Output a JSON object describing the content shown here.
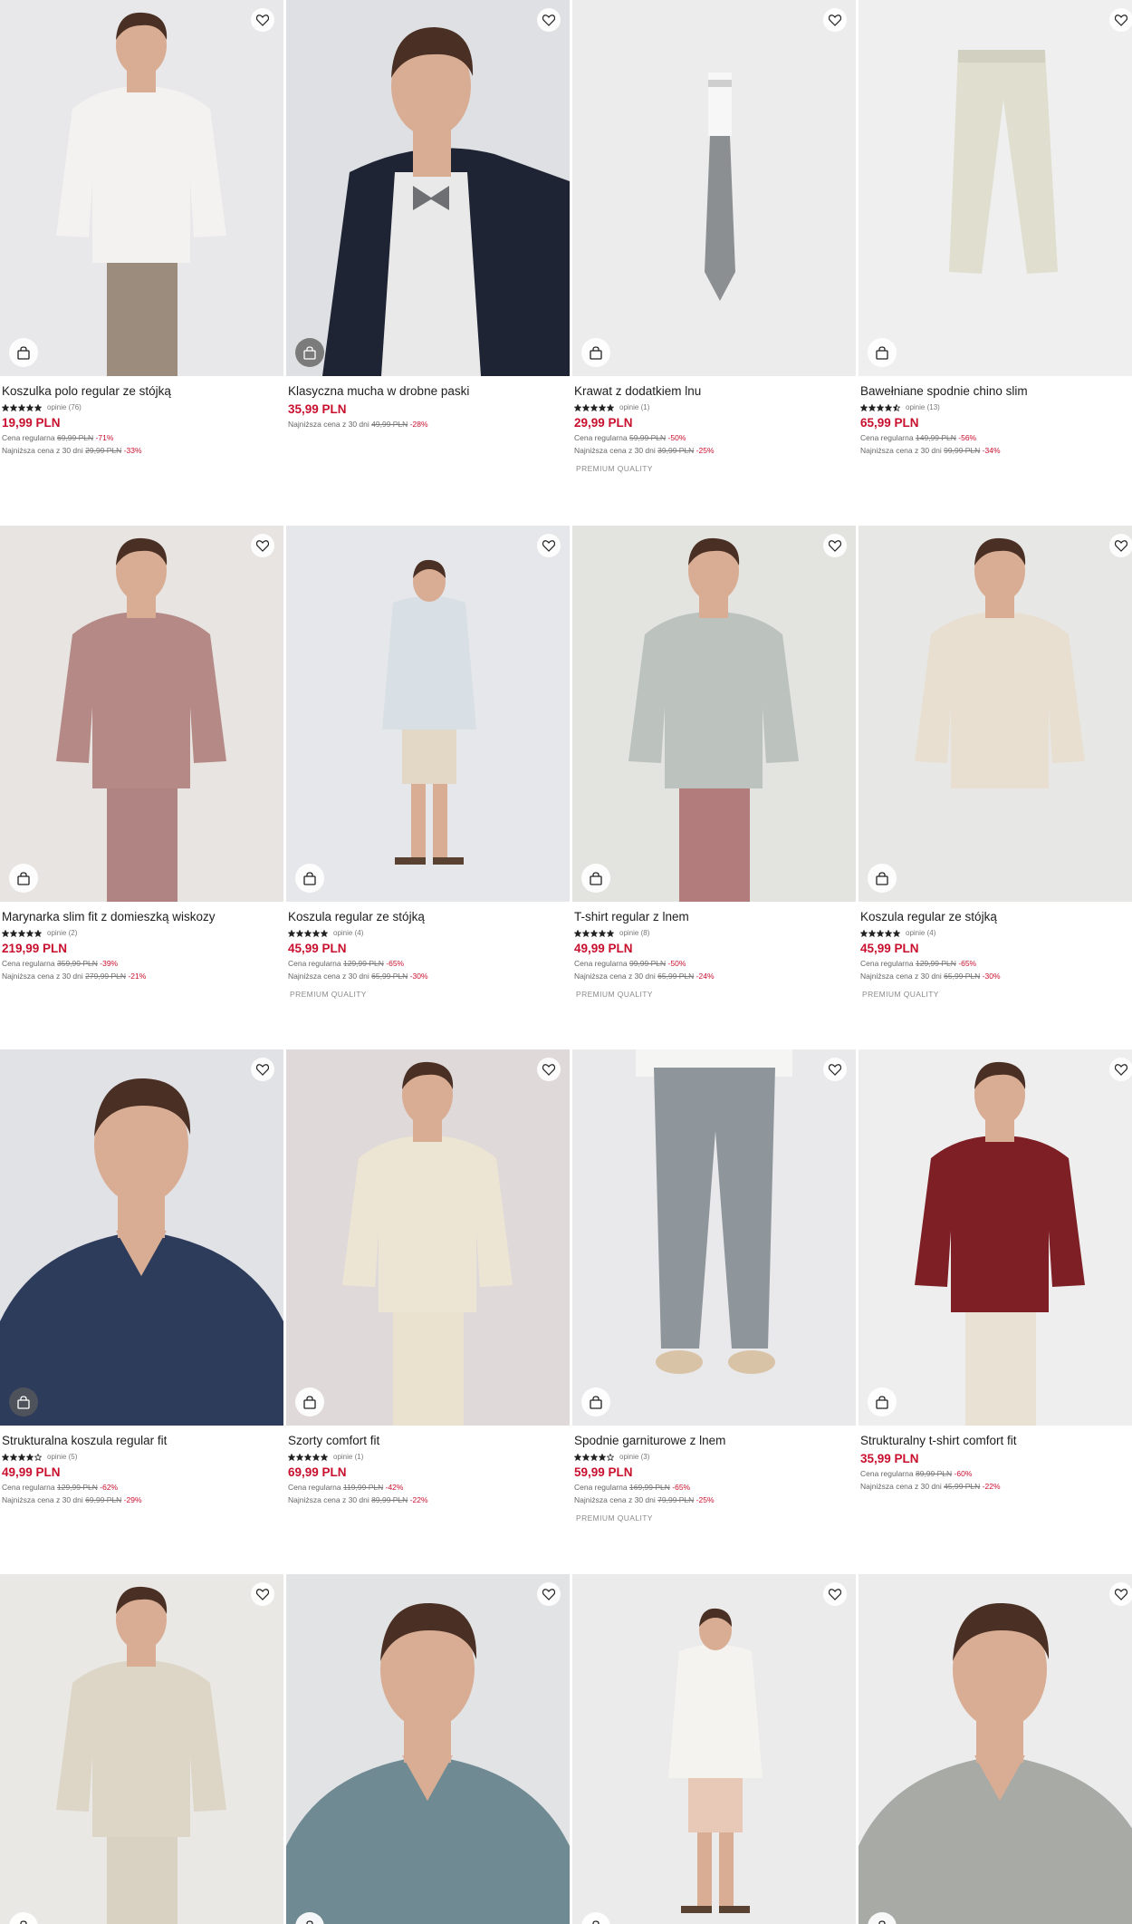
{
  "colors": {
    "price_red": "#c8102e",
    "text": "#1d1d1d",
    "muted": "#777777",
    "background": "#ffffff"
  },
  "icons": {
    "favorite": "heart-icon",
    "cart": "shopping-bag-icon",
    "rating": "star-icon"
  },
  "products": [
    {
      "name": "Koszulka polo regular ze stójką",
      "rating": 5,
      "reviews": "opinie (76)",
      "price": "19,99 PLN",
      "regular_label": "Cena regularna",
      "regular_price": "69,99 PLN",
      "regular_discount": "-71%",
      "lowest_label": "Najniższa cena z 30 dni",
      "lowest_price": "29,99 PLN",
      "lowest_discount": "-33%",
      "badge": "",
      "photo": {
        "bg": "#e8e7ea",
        "item": "#f3f2f1",
        "lower": "#9c8c7e",
        "type": "model"
      }
    },
    {
      "name": "Klasyczna mucha w drobne paski",
      "rating": 0,
      "reviews": "",
      "price": "35,99 PLN",
      "regular_label": "",
      "regular_price": "",
      "regular_discount": "",
      "lowest_label": "Najniższa cena z 30 dni",
      "lowest_price": "49,99 PLN",
      "lowest_discount": "-28%",
      "badge": "",
      "photo": {
        "bg": "#dfe0e3",
        "item": "#1e2433",
        "lower": "#e9e9ea",
        "type": "suit"
      }
    },
    {
      "name": "Krawat z dodatkiem lnu",
      "rating": 5,
      "reviews": "opinie (1)",
      "price": "29,99 PLN",
      "regular_label": "Cena regularna",
      "regular_price": "59,99 PLN",
      "regular_discount": "-50%",
      "lowest_label": "Najniższa cena z 30 dni",
      "lowest_price": "39,99 PLN",
      "lowest_discount": "-25%",
      "badge": "PREMIUM QUALITY",
      "photo": {
        "bg": "#ececec",
        "item": "#8c8f92",
        "lower": "#ececec",
        "type": "tie"
      }
    },
    {
      "name": "Bawełniane spodnie chino slim",
      "rating": 4.5,
      "reviews": "opinie (13)",
      "price": "65,99 PLN",
      "regular_label": "Cena regularna",
      "regular_price": "149,99 PLN",
      "regular_discount": "-56%",
      "lowest_label": "Najniższa cena z 30 dni",
      "lowest_price": "99,99 PLN",
      "lowest_discount": "-34%",
      "badge": "",
      "photo": {
        "bg": "#efefef",
        "item": "#e0dfcf",
        "lower": "#efefef",
        "type": "pants"
      }
    },
    {
      "name": "Marynarka slim fit z domieszką wiskozy",
      "rating": 5,
      "reviews": "opinie (2)",
      "price": "219,99 PLN",
      "regular_label": "Cena regularna",
      "regular_price": "359,99 PLN",
      "regular_discount": "-39%",
      "lowest_label": "Najniższa cena z 30 dni",
      "lowest_price": "279,99 PLN",
      "lowest_discount": "-21%",
      "badge": "",
      "photo": {
        "bg": "#e7e4e1",
        "item": "#b58a86",
        "lower": "#b08482",
        "type": "model"
      }
    },
    {
      "name": "Koszula regular ze stójką",
      "rating": 5,
      "reviews": "opinie (4)",
      "price": "45,99 PLN",
      "regular_label": "Cena regularna",
      "regular_price": "129,99 PLN",
      "regular_discount": "-65%",
      "lowest_label": "Najniższa cena z 30 dni",
      "lowest_price": "65,99 PLN",
      "lowest_discount": "-30%",
      "badge": "PREMIUM QUALITY",
      "photo": {
        "bg": "#e6e7ea",
        "item": "#d8e0e6",
        "lower": "#e3d8c6",
        "type": "full"
      }
    },
    {
      "name": "T-shirt regular z lnem",
      "rating": 5,
      "reviews": "opinie (8)",
      "price": "49,99 PLN",
      "regular_label": "Cena regularna",
      "regular_price": "99,99 PLN",
      "regular_discount": "-50%",
      "lowest_label": "Najniższa cena z 30 dni",
      "lowest_price": "65,99 PLN",
      "lowest_discount": "-24%",
      "badge": "PREMIUM QUALITY",
      "photo": {
        "bg": "#e3e3df",
        "item": "#bcc2bd",
        "lower": "#b37c7c",
        "type": "model"
      }
    },
    {
      "name": "Koszula regular ze stójką",
      "rating": 5,
      "reviews": "opinie (4)",
      "price": "45,99 PLN",
      "regular_label": "Cena regularna",
      "regular_price": "129,99 PLN",
      "regular_discount": "-65%",
      "lowest_label": "Najniższa cena z 30 dni",
      "lowest_price": "65,99 PLN",
      "lowest_discount": "-30%",
      "badge": "PREMIUM QUALITY",
      "photo": {
        "bg": "#e7e7e5",
        "item": "#e8dfd1",
        "lower": "#e7e7e5",
        "type": "model"
      }
    },
    {
      "name": "Strukturalna koszula regular fit",
      "rating": 4,
      "reviews": "opinie (5)",
      "price": "49,99 PLN",
      "regular_label": "Cena regularna",
      "regular_price": "129,99 PLN",
      "regular_discount": "-62%",
      "lowest_label": "Najniższa cena z 30 dni",
      "lowest_price": "69,99 PLN",
      "lowest_discount": "-29%",
      "badge": "",
      "photo": {
        "bg": "#e1e2e6",
        "item": "#2e3c5c",
        "lower": "#2e3c5c",
        "type": "portrait"
      }
    },
    {
      "name": "Szorty comfort fit",
      "rating": 5,
      "reviews": "opinie (1)",
      "price": "69,99 PLN",
      "regular_label": "Cena regularna",
      "regular_price": "119,99 PLN",
      "regular_discount": "-42%",
      "lowest_label": "Najniższa cena z 30 dni",
      "lowest_price": "89,99 PLN",
      "lowest_discount": "-22%",
      "badge": "",
      "photo": {
        "bg": "#e0d9da",
        "item": "#ece5d3",
        "lower": "#eae2cf",
        "type": "model"
      }
    },
    {
      "name": "Spodnie garniturowe z lnem",
      "rating": 4,
      "reviews": "opinie (3)",
      "price": "59,99 PLN",
      "regular_label": "Cena regularna",
      "regular_price": "169,99 PLN",
      "regular_discount": "-65%",
      "lowest_label": "Najniższa cena z 30 dni",
      "lowest_price": "79,99 PLN",
      "lowest_discount": "-25%",
      "badge": "PREMIUM QUALITY",
      "photo": {
        "bg": "#e9e8ea",
        "item": "#f5f5f3",
        "lower": "#8e969c",
        "type": "legs"
      }
    },
    {
      "name": "Strukturalny t-shirt comfort fit",
      "rating": 0,
      "reviews": "",
      "price": "35,99 PLN",
      "regular_label": "Cena regularna",
      "regular_price": "89,99 PLN",
      "regular_discount": "-60%",
      "lowest_label": "Najniższa cena z 30 dni",
      "lowest_price": "45,99 PLN",
      "lowest_discount": "-22%",
      "badge": "",
      "photo": {
        "bg": "#eeeeee",
        "item": "#7d1f25",
        "lower": "#e9e1d3",
        "type": "model"
      }
    },
    {
      "name": "",
      "rating": 0,
      "reviews": "",
      "price": "",
      "regular_label": "",
      "regular_price": "",
      "regular_discount": "",
      "lowest_label": "",
      "lowest_price": "",
      "lowest_discount": "",
      "badge": "",
      "photo": {
        "bg": "#e9e8e5",
        "item": "#ddd6c6",
        "lower": "#d9d2c2",
        "type": "model"
      }
    },
    {
      "name": "",
      "rating": 0,
      "reviews": "",
      "price": "",
      "regular_label": "",
      "regular_price": "",
      "regular_discount": "",
      "lowest_label": "",
      "lowest_price": "",
      "lowest_discount": "",
      "badge": "",
      "photo": {
        "bg": "#e2e3e5",
        "item": "#6f8a93",
        "lower": "#1f2430",
        "type": "portrait"
      }
    },
    {
      "name": "",
      "rating": 0,
      "reviews": "",
      "price": "",
      "regular_label": "",
      "regular_price": "",
      "regular_discount": "",
      "lowest_label": "",
      "lowest_price": "",
      "lowest_discount": "",
      "badge": "",
      "photo": {
        "bg": "#ebebeb",
        "item": "#f4f3ef",
        "lower": "#e8c9b8",
        "type": "full"
      }
    },
    {
      "name": "",
      "rating": 0,
      "reviews": "",
      "price": "",
      "regular_label": "",
      "regular_price": "",
      "regular_discount": "",
      "lowest_label": "",
      "lowest_price": "",
      "lowest_discount": "",
      "badge": "",
      "photo": {
        "bg": "#ececec",
        "item": "#a8aaa6",
        "lower": "#ececec",
        "type": "portrait"
      }
    }
  ]
}
